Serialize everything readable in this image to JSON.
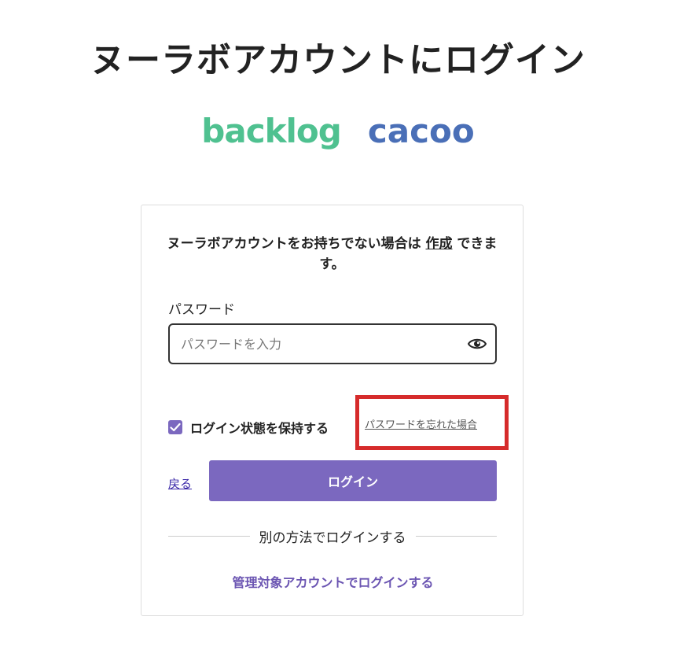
{
  "header": {
    "title": "ヌーラボアカウントにログイン"
  },
  "brands": {
    "backlog": "backlog",
    "backlog_color": "#4fc190",
    "cacoo": "cacoo",
    "cacoo_color": "#4a6fb7"
  },
  "card": {
    "signup_prefix": "ヌーラボアカウントをお持ちでない場合は",
    "signup_link": "作成",
    "signup_suffix": "できます。",
    "password_label": "パスワード",
    "password_placeholder": "パスワードを入力",
    "password_value": "",
    "show_password_icon": "eye-icon",
    "remember_label": "ログイン状態を保持する",
    "remember_checked": true,
    "forgot_link": "パスワードを忘れた場合",
    "back_link": "戻る",
    "login_button": "ログイン",
    "alt_login_divider": "別の方法でログインする",
    "managed_account_link": "管理対象アカウントでログインする"
  },
  "colors": {
    "accent": "#7b68bf",
    "highlight": "#d62b2b"
  }
}
